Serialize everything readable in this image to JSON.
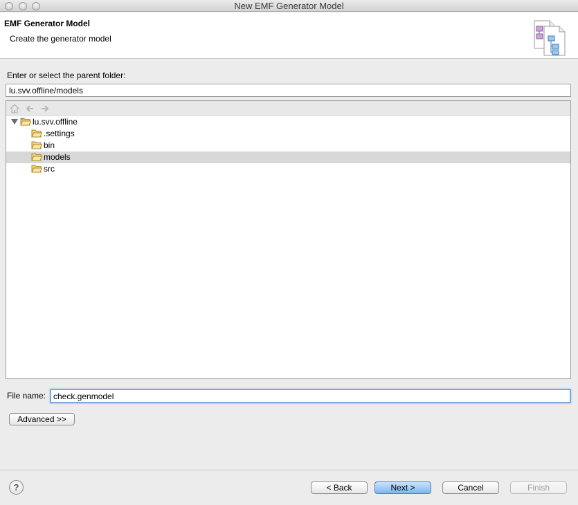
{
  "window": {
    "title": "New EMF Generator Model",
    "controls": [
      "close",
      "minimize",
      "zoom"
    ]
  },
  "header": {
    "title": "EMF Generator Model",
    "description": "Create the generator model",
    "icon": "new-genmodel-wizard-icon"
  },
  "parent_folder": {
    "label": "Enter or select the parent folder:",
    "value": "lu.svv.offline/models"
  },
  "tree_toolbar": {
    "icons": [
      "home-icon",
      "back-arrow-icon",
      "forward-arrow-icon"
    ]
  },
  "tree": {
    "root": {
      "label": "lu.svv.offline",
      "expanded": true,
      "icon": "open-project-folder-icon"
    },
    "children": [
      {
        "label": ".settings",
        "selected": false
      },
      {
        "label": "bin",
        "selected": false
      },
      {
        "label": "models",
        "selected": true
      },
      {
        "label": "src",
        "selected": false
      }
    ]
  },
  "file_name": {
    "label": "File name:",
    "value": "check.genmodel"
  },
  "buttons": {
    "advanced": "Advanced >>",
    "back": "< Back",
    "next": "Next >",
    "cancel": "Cancel",
    "finish": "Finish"
  },
  "help": {
    "glyph": "?"
  },
  "colors": {
    "selection": "#d8d8d8",
    "default_button": "#7fb6ef",
    "focus_ring": "#7ea9d8"
  }
}
